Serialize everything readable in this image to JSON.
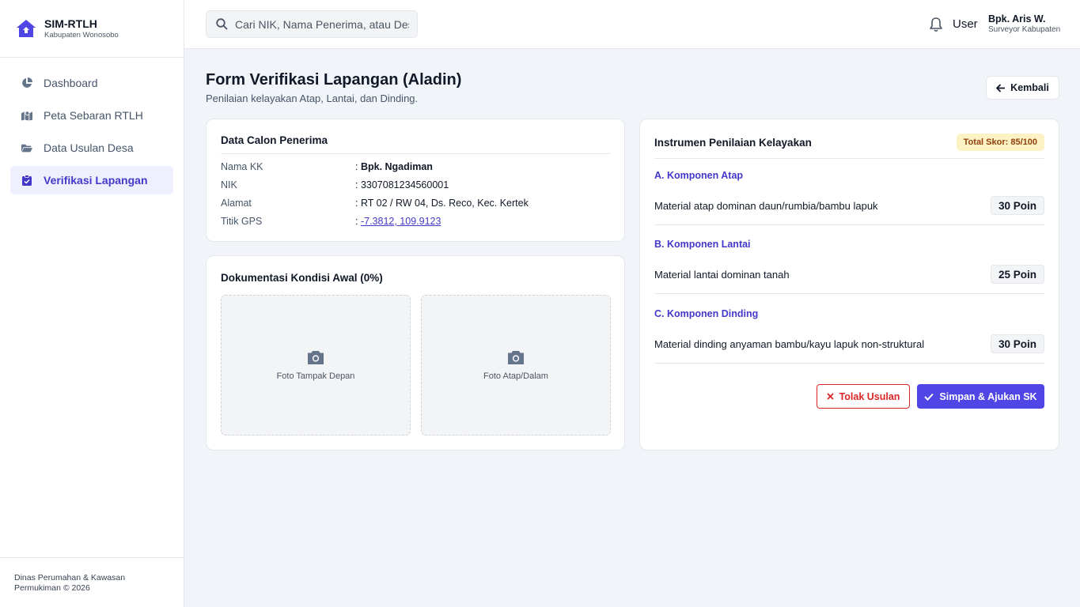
{
  "brand": {
    "title": "SIM-RTLH",
    "subtitle": "Kabupaten Wonosobo"
  },
  "sidebar": {
    "items": [
      {
        "label": "Dashboard",
        "icon": "pie-chart-icon",
        "active": false
      },
      {
        "label": "Peta Sebaran RTLH",
        "icon": "map-icon",
        "active": false
      },
      {
        "label": "Data Usulan Desa",
        "icon": "folder-open-icon",
        "active": false
      },
      {
        "label": "Verifikasi Lapangan",
        "icon": "clipboard-check-icon",
        "active": true
      }
    ],
    "footer": "Dinas Perumahan & Kawasan Permukiman © 2026"
  },
  "header": {
    "search_placeholder": "Cari NIK, Nama Penerima, atau Desa...",
    "user_role": "User",
    "user_name": "Bpk. Aris W.",
    "user_title": "Surveyor Kabupaten"
  },
  "page": {
    "title": "Form Verifikasi Lapangan (Aladin)",
    "subtitle": "Penilaian kelayakan Atap, Lantai, dan Dinding.",
    "back_label": "Kembali"
  },
  "recipient": {
    "title": "Data Calon Penerima",
    "rows": [
      {
        "label": "Nama KK",
        "value": "Bpk. Ngadiman"
      },
      {
        "label": "NIK",
        "value": "3307081234560001"
      },
      {
        "label": "Alamat",
        "value": "RT 02 / RW 04, Ds. Reco, Kec. Kertek"
      },
      {
        "label": "Titik GPS",
        "value": "-7.3812, 109.9123"
      }
    ]
  },
  "documentation": {
    "title": "Dokumentasi Kondisi Awal (0%)",
    "photos": [
      {
        "label": "Foto Tampak Depan"
      },
      {
        "label": "Foto Atap/Dalam"
      }
    ]
  },
  "assessment": {
    "title": "Instrumen Penilaian Kelayakan",
    "total_score": "Total Skor: 85/100",
    "sections": [
      {
        "title": "A. Komponen Atap",
        "criterion": "Material atap dominan daun/rumbia/bambu lapuk",
        "points": "30 Poin"
      },
      {
        "title": "B. Komponen Lantai",
        "criterion": "Material lantai dominan tanah",
        "points": "25 Poin"
      },
      {
        "title": "C. Komponen Dinding",
        "criterion": "Material dinding anyaman bambu/kayu lapuk non-struktural",
        "points": "30 Poin"
      }
    ],
    "reject_label": "Tolak Usulan",
    "submit_label": "Simpan & Ajukan SK"
  },
  "colors": {
    "accent": "#4f46e5",
    "danger": "#dc2626",
    "badge_bg": "#fdf2c4"
  }
}
